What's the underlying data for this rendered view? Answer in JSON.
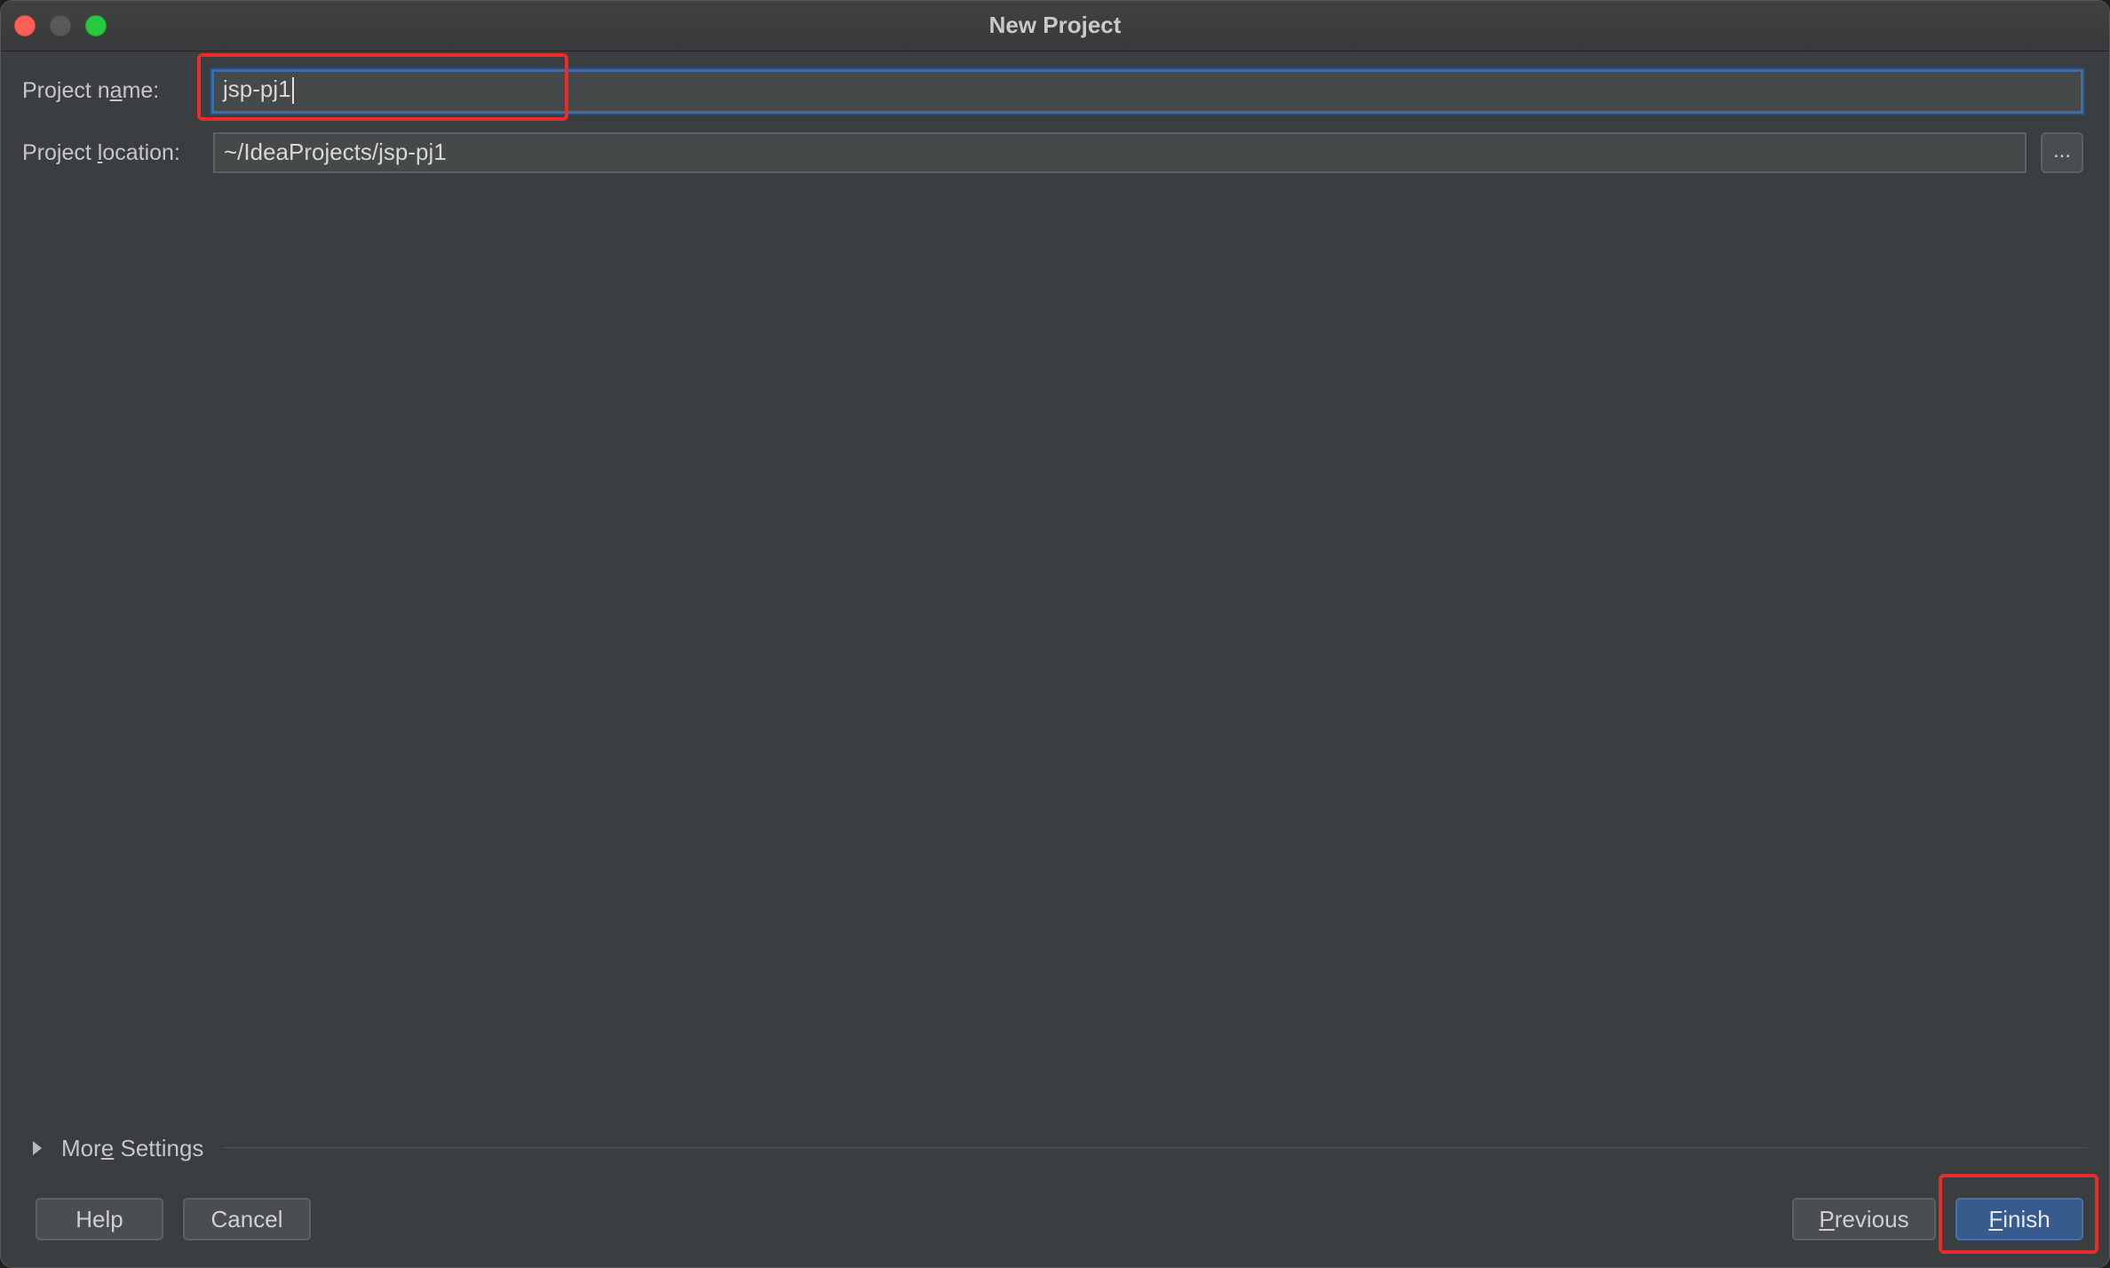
{
  "window": {
    "title": "New Project"
  },
  "form": {
    "project_name": {
      "label_pre": "Project n",
      "label_u": "a",
      "label_post": "me:",
      "value": "jsp-pj1"
    },
    "project_location": {
      "label_pre": "Project ",
      "label_u": "l",
      "label_post": "ocation:",
      "value": "~/IdeaProjects/jsp-pj1",
      "browse_label": "..."
    }
  },
  "more_settings": {
    "label_pre": "Mor",
    "label_u": "e",
    "label_post": " Settings"
  },
  "buttons": {
    "help": "Help",
    "cancel": "Cancel",
    "previous_u": "P",
    "previous_rest": "revious",
    "finish_u": "F",
    "finish_rest": "inish"
  },
  "colors": {
    "background": "#3b3e40",
    "accent": "#365b8c",
    "focus_border": "#3d6da4",
    "annotation": "#ea2b2b"
  }
}
